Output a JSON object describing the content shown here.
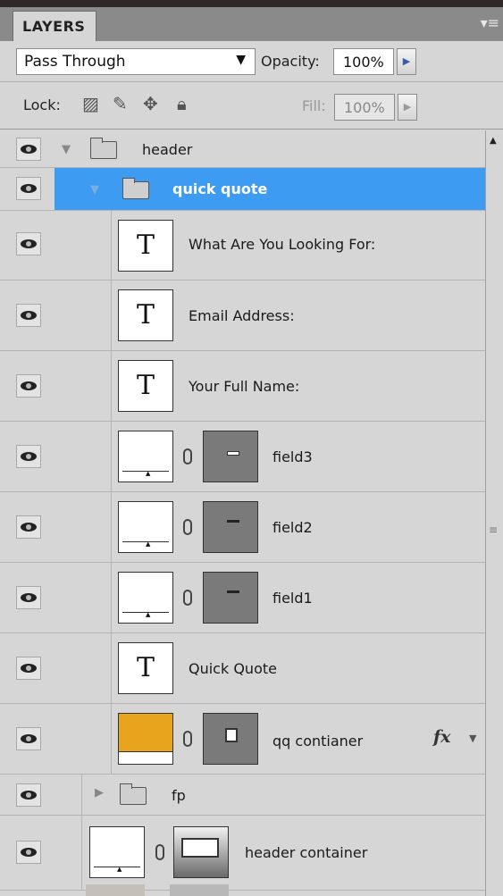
{
  "tabbar": {
    "tab_label": "LAYERS",
    "menu_icon": "panel-menu-icon"
  },
  "blend": {
    "mode": "Pass Through"
  },
  "opacity": {
    "label": "Opacity:",
    "value": "100%"
  },
  "lock": {
    "label": "Lock:"
  },
  "fill": {
    "label": "Fill:",
    "value": "100%"
  },
  "layers": [
    {
      "name": "header",
      "type": "group",
      "expanded": true
    },
    {
      "name": "quick quote",
      "type": "group",
      "expanded": true,
      "selected": true
    },
    {
      "name": "What Are You Looking For:",
      "type": "text"
    },
    {
      "name": "Email Address:",
      "type": "text"
    },
    {
      "name": "Your Full Name:",
      "type": "text"
    },
    {
      "name": "field3",
      "type": "shape"
    },
    {
      "name": "field2",
      "type": "shape"
    },
    {
      "name": "field1",
      "type": "shape"
    },
    {
      "name": "Quick Quote",
      "type": "text"
    },
    {
      "name": "qq contianer",
      "type": "shape",
      "thumb_color": "#e8a41c",
      "effects": "fx"
    },
    {
      "name": "fp",
      "type": "group",
      "expanded": false
    },
    {
      "name": "header container",
      "type": "shape"
    }
  ],
  "colors": {
    "selection": "#3d9bf2",
    "panel": "#d6d6d6"
  }
}
